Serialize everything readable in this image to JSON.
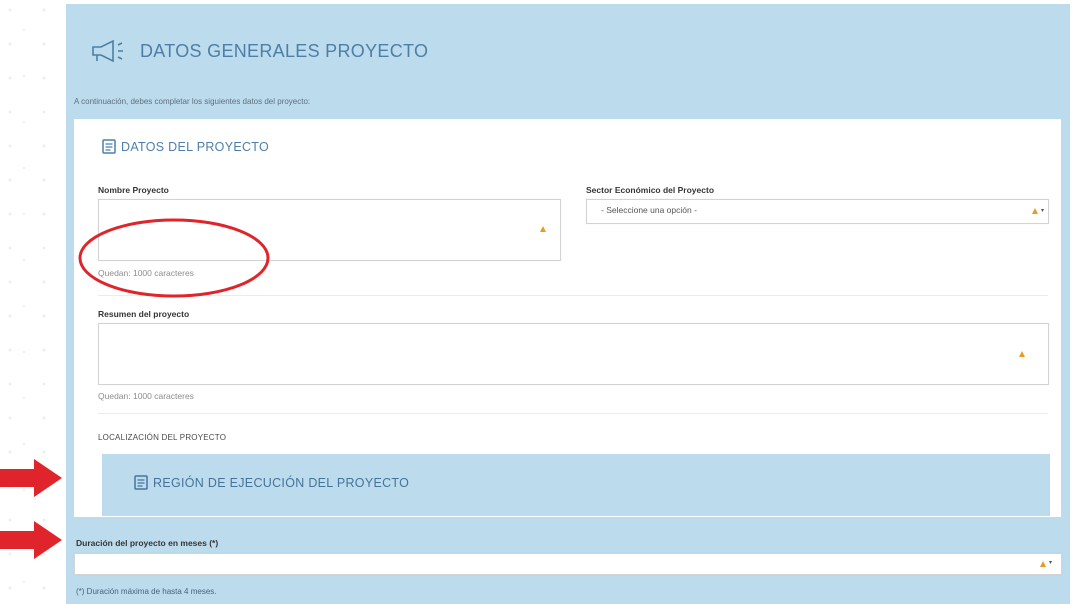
{
  "header": {
    "title": "DATOS GENERALES PROYECTO"
  },
  "intro": "A continuación, debes completar los siguientes datos del proyecto:",
  "project_section": {
    "title": "DATOS DEL PROYECTO",
    "name_label": "Nombre Proyecto",
    "name_value": "",
    "name_counter": "Quedan: 1000 caracteres",
    "sector_label": "Sector Económico del Proyecto",
    "sector_value": "- Seleccione una opción -",
    "summary_label": "Resumen del proyecto",
    "summary_value": "",
    "summary_counter": "Quedan: 1000 caracteres",
    "location_label": "LOCALIZACIÓN DEL PROYECTO",
    "region_title": "REGIÓN DE EJECUCIÓN DEL PROYECTO"
  },
  "duration": {
    "label": "Duración del proyecto en meses (*)",
    "value": "",
    "note": "(*) Duración máxima de hasta 4 meses."
  },
  "icons": [
    "megaphone-icon",
    "document-icon",
    "warning-icon",
    "chevron-down-icon",
    "arrow-right-icon"
  ],
  "colors": {
    "panel": "#bcdcee",
    "title": "#4d7fa6",
    "warning": "#e79b22",
    "annotation_red": "#e0242c"
  }
}
